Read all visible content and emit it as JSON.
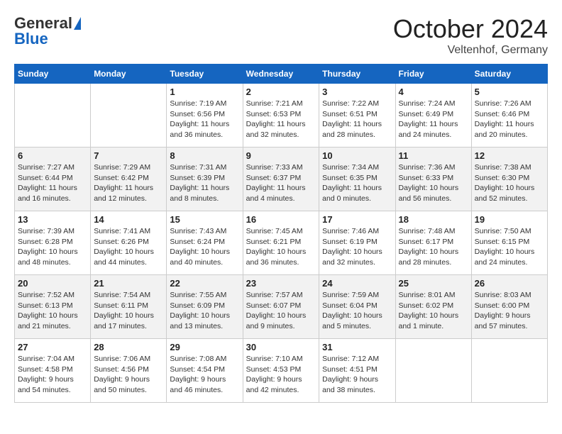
{
  "header": {
    "logo_general": "General",
    "logo_blue": "Blue",
    "month": "October 2024",
    "location": "Veltenhof, Germany"
  },
  "weekdays": [
    "Sunday",
    "Monday",
    "Tuesday",
    "Wednesday",
    "Thursday",
    "Friday",
    "Saturday"
  ],
  "weeks": [
    [
      {
        "day": "",
        "content": ""
      },
      {
        "day": "",
        "content": ""
      },
      {
        "day": "1",
        "content": "Sunrise: 7:19 AM\nSunset: 6:56 PM\nDaylight: 11 hours and 36 minutes."
      },
      {
        "day": "2",
        "content": "Sunrise: 7:21 AM\nSunset: 6:53 PM\nDaylight: 11 hours and 32 minutes."
      },
      {
        "day": "3",
        "content": "Sunrise: 7:22 AM\nSunset: 6:51 PM\nDaylight: 11 hours and 28 minutes."
      },
      {
        "day": "4",
        "content": "Sunrise: 7:24 AM\nSunset: 6:49 PM\nDaylight: 11 hours and 24 minutes."
      },
      {
        "day": "5",
        "content": "Sunrise: 7:26 AM\nSunset: 6:46 PM\nDaylight: 11 hours and 20 minutes."
      }
    ],
    [
      {
        "day": "6",
        "content": "Sunrise: 7:27 AM\nSunset: 6:44 PM\nDaylight: 11 hours and 16 minutes."
      },
      {
        "day": "7",
        "content": "Sunrise: 7:29 AM\nSunset: 6:42 PM\nDaylight: 11 hours and 12 minutes."
      },
      {
        "day": "8",
        "content": "Sunrise: 7:31 AM\nSunset: 6:39 PM\nDaylight: 11 hours and 8 minutes."
      },
      {
        "day": "9",
        "content": "Sunrise: 7:33 AM\nSunset: 6:37 PM\nDaylight: 11 hours and 4 minutes."
      },
      {
        "day": "10",
        "content": "Sunrise: 7:34 AM\nSunset: 6:35 PM\nDaylight: 11 hours and 0 minutes."
      },
      {
        "day": "11",
        "content": "Sunrise: 7:36 AM\nSunset: 6:33 PM\nDaylight: 10 hours and 56 minutes."
      },
      {
        "day": "12",
        "content": "Sunrise: 7:38 AM\nSunset: 6:30 PM\nDaylight: 10 hours and 52 minutes."
      }
    ],
    [
      {
        "day": "13",
        "content": "Sunrise: 7:39 AM\nSunset: 6:28 PM\nDaylight: 10 hours and 48 minutes."
      },
      {
        "day": "14",
        "content": "Sunrise: 7:41 AM\nSunset: 6:26 PM\nDaylight: 10 hours and 44 minutes."
      },
      {
        "day": "15",
        "content": "Sunrise: 7:43 AM\nSunset: 6:24 PM\nDaylight: 10 hours and 40 minutes."
      },
      {
        "day": "16",
        "content": "Sunrise: 7:45 AM\nSunset: 6:21 PM\nDaylight: 10 hours and 36 minutes."
      },
      {
        "day": "17",
        "content": "Sunrise: 7:46 AM\nSunset: 6:19 PM\nDaylight: 10 hours and 32 minutes."
      },
      {
        "day": "18",
        "content": "Sunrise: 7:48 AM\nSunset: 6:17 PM\nDaylight: 10 hours and 28 minutes."
      },
      {
        "day": "19",
        "content": "Sunrise: 7:50 AM\nSunset: 6:15 PM\nDaylight: 10 hours and 24 minutes."
      }
    ],
    [
      {
        "day": "20",
        "content": "Sunrise: 7:52 AM\nSunset: 6:13 PM\nDaylight: 10 hours and 21 minutes."
      },
      {
        "day": "21",
        "content": "Sunrise: 7:54 AM\nSunset: 6:11 PM\nDaylight: 10 hours and 17 minutes."
      },
      {
        "day": "22",
        "content": "Sunrise: 7:55 AM\nSunset: 6:09 PM\nDaylight: 10 hours and 13 minutes."
      },
      {
        "day": "23",
        "content": "Sunrise: 7:57 AM\nSunset: 6:07 PM\nDaylight: 10 hours and 9 minutes."
      },
      {
        "day": "24",
        "content": "Sunrise: 7:59 AM\nSunset: 6:04 PM\nDaylight: 10 hours and 5 minutes."
      },
      {
        "day": "25",
        "content": "Sunrise: 8:01 AM\nSunset: 6:02 PM\nDaylight: 10 hours and 1 minute."
      },
      {
        "day": "26",
        "content": "Sunrise: 8:03 AM\nSunset: 6:00 PM\nDaylight: 9 hours and 57 minutes."
      }
    ],
    [
      {
        "day": "27",
        "content": "Sunrise: 7:04 AM\nSunset: 4:58 PM\nDaylight: 9 hours and 54 minutes."
      },
      {
        "day": "28",
        "content": "Sunrise: 7:06 AM\nSunset: 4:56 PM\nDaylight: 9 hours and 50 minutes."
      },
      {
        "day": "29",
        "content": "Sunrise: 7:08 AM\nSunset: 4:54 PM\nDaylight: 9 hours and 46 minutes."
      },
      {
        "day": "30",
        "content": "Sunrise: 7:10 AM\nSunset: 4:53 PM\nDaylight: 9 hours and 42 minutes."
      },
      {
        "day": "31",
        "content": "Sunrise: 7:12 AM\nSunset: 4:51 PM\nDaylight: 9 hours and 38 minutes."
      },
      {
        "day": "",
        "content": ""
      },
      {
        "day": "",
        "content": ""
      }
    ]
  ]
}
